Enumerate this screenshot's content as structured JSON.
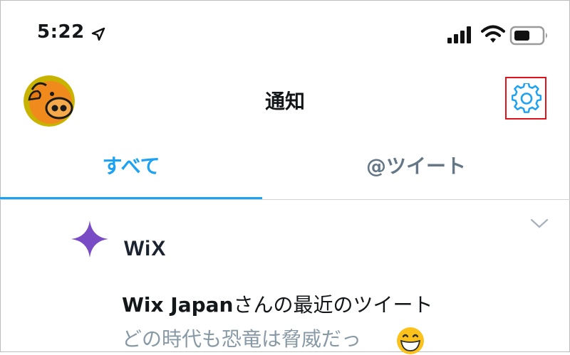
{
  "status_bar": {
    "time": "5:22",
    "icons": [
      "location-arrow-icon",
      "signal-icon",
      "wifi-icon",
      "battery-icon"
    ]
  },
  "header": {
    "title": "通知",
    "avatar": "avatar",
    "settings_icon": "gear-icon"
  },
  "tabs": [
    {
      "label": "すべて",
      "active": true
    },
    {
      "label": "@ツイート",
      "active": false
    }
  ],
  "notification": {
    "logo_text": "WiX",
    "account_name": "Wix Japan",
    "message_suffix": "さんの最近のツイート",
    "preview": "どの時代も恐竜は脅威だっ",
    "icons": [
      "star-icon",
      "chevron-down-icon",
      "grinning-face-emoji"
    ]
  },
  "colors": {
    "accent": "#1da1f2",
    "highlight_border": "#e0131b",
    "inactive_tab": "#657786",
    "preview_text": "#8899a6",
    "star": "#794bc4"
  }
}
